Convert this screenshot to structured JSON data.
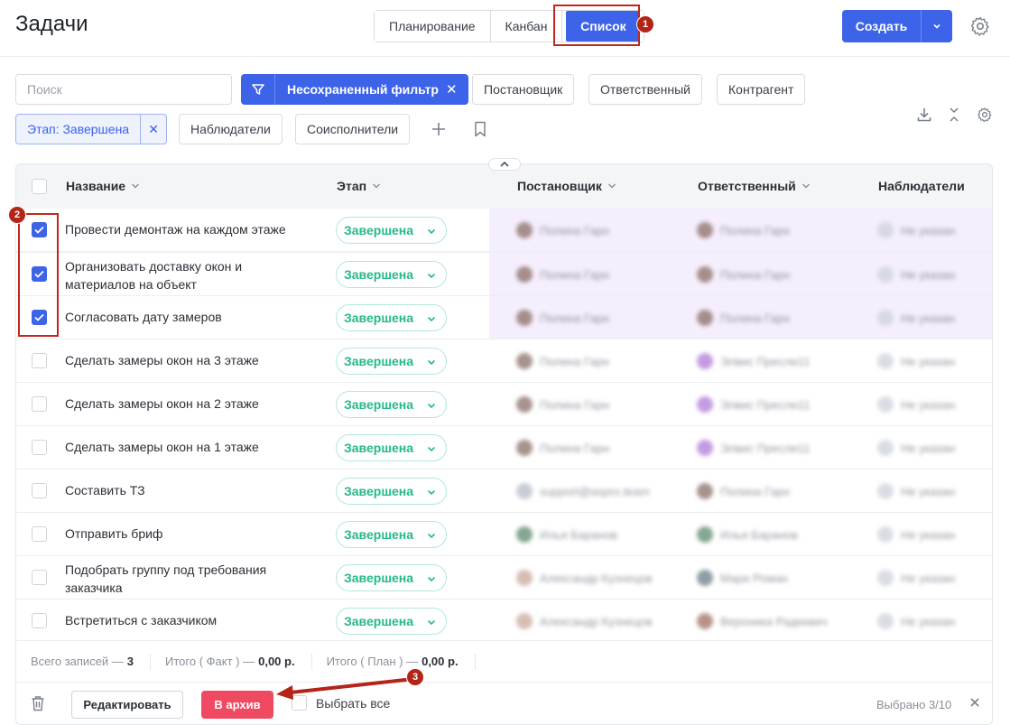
{
  "header": {
    "title": "Задачи",
    "tabs": [
      {
        "label": "Планирование"
      },
      {
        "label": "Канбан"
      },
      {
        "label": "Список",
        "active": true
      }
    ],
    "create_label": "Создать"
  },
  "filters": {
    "search_placeholder": "Поиск",
    "active_filter": "Несохраненный фильтр",
    "chips": [
      "Постановщик",
      "Ответственный",
      "Контрагент",
      "Наблюдатели",
      "Соисполнители"
    ],
    "stage_chip": "Этап: Завершена"
  },
  "table": {
    "columns": [
      "Название",
      "Этап",
      "Постановщик",
      "Ответственный",
      "Наблюдатели"
    ],
    "rows": [
      {
        "name": "Провести демонтаж на каждом этаже",
        "stage": "Завершена",
        "author": "Полина Гарн",
        "assignee": "Полина Гарн",
        "watchers": "Не указан",
        "checked": true
      },
      {
        "name": "Организовать доставку окон и\nматериалов на объект",
        "stage": "Завершена",
        "author": "Полина Гарн",
        "assignee": "Полина Гарн",
        "watchers": "Не указан",
        "checked": true
      },
      {
        "name": "Согласовать дату замеров",
        "stage": "Завершена",
        "author": "Полина Гарн",
        "assignee": "Полина Гарн",
        "watchers": "Не указан",
        "checked": true
      },
      {
        "name": "Сделать замеры окон на 3 этаже",
        "stage": "Завершена",
        "author": "Полина Гарн",
        "assignee": "Элвис Пресли11",
        "watchers": "Не указан",
        "checked": false
      },
      {
        "name": "Сделать замеры окон на 2 этаже",
        "stage": "Завершена",
        "author": "Полина Гарн",
        "assignee": "Элвис Пресли11",
        "watchers": "Не указан",
        "checked": false
      },
      {
        "name": "Сделать замеры окон на 1 этаже",
        "stage": "Завершена",
        "author": "Полина Гарн",
        "assignee": "Элвис Пресли11",
        "watchers": "Не указан",
        "checked": false
      },
      {
        "name": "Составить ТЗ",
        "stage": "Завершена",
        "author": "support@aspro.team",
        "assignee": "Полина Гарн",
        "watchers": "Не указан",
        "checked": false
      },
      {
        "name": "Отправить бриф",
        "stage": "Завершена",
        "author": "Илья Баранов",
        "assignee": "Илья Баранов",
        "watchers": "Не указан",
        "checked": false
      },
      {
        "name": "Подобрать группу под требования\nзаказчика",
        "stage": "Завершена",
        "author": "Александр Кузнецов",
        "assignee": "Мари Роман",
        "watchers": "Не указан",
        "checked": false
      },
      {
        "name": "Встретиться с заказчиком",
        "stage": "Завершена",
        "author": "Александр Кузнецов",
        "assignee": "Вероника Радкевич",
        "watchers": "Не указан",
        "checked": false
      }
    ]
  },
  "summary": {
    "total_label": "Всего записей —",
    "total_value": "3",
    "fact_label": "Итого ( Факт ) —",
    "fact_value": "0,00 р.",
    "plan_label": "Итого ( План ) —",
    "plan_value": "0,00 р."
  },
  "actions": {
    "edit_label": "Редактировать",
    "archive_label": "В архив",
    "select_all_label": "Выбрать все",
    "selected_count": "Выбрано 3/10"
  },
  "annotations": [
    "1",
    "2",
    "3"
  ],
  "colors": {
    "accent": "#3c63e8",
    "stage_green": "#25b98a",
    "archive_red": "#ef4a62",
    "selected_row": "#f5eefc",
    "annotation_red": "#c0281e"
  }
}
